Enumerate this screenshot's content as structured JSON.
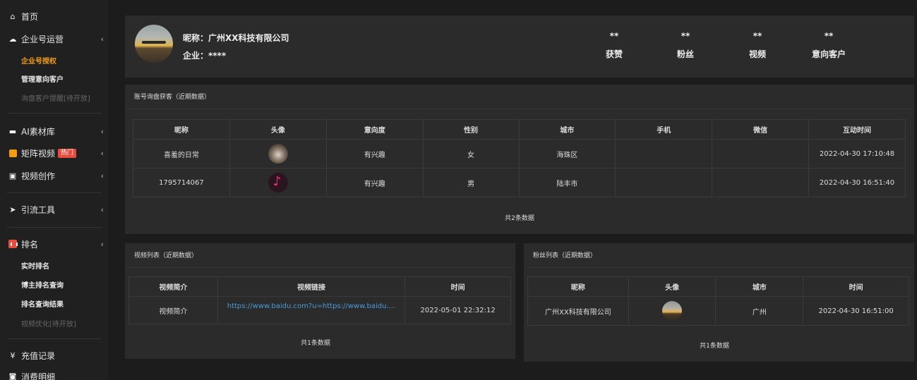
{
  "sidebar": {
    "home": "首页",
    "enterprise": "企业号运营",
    "enterprise_sub": [
      "企业号授权",
      "管理意向客户",
      "询盘客户提醒[待开放]"
    ],
    "ai_material": "AI素材库",
    "matrix_video": "矩阵视频",
    "hot_badge": "热门",
    "video_create": "视频创作",
    "traffic_tool": "引流工具",
    "ranking": "排名",
    "ranking_sub": [
      "实时排名",
      "博主排名查询",
      "排名查询结果",
      "视频优化[待开放]"
    ],
    "recharge": "充值记录",
    "consumption": "消费明细",
    "chevron": "‹"
  },
  "profile": {
    "nickname": "昵称：广州XX科技有限公司",
    "company": "企业：****",
    "stats": [
      {
        "value": "**",
        "label": "获赞"
      },
      {
        "value": "**",
        "label": "粉丝"
      },
      {
        "value": "**",
        "label": "视频"
      },
      {
        "value": "**",
        "label": "意向客户"
      }
    ]
  },
  "inquiry": {
    "title": "账号询盘获客（近期数据）",
    "headers": [
      "昵称",
      "头像",
      "意向度",
      "性别",
      "城市",
      "手机",
      "微信",
      "互动时间"
    ],
    "rows": [
      {
        "nickname": "喜羞的日常",
        "avatar": "dog-avatar",
        "intent": "有兴趣",
        "gender": "女",
        "city": "海珠区",
        "phone": "",
        "wechat": "",
        "time": "2022-04-30 17:10:48"
      },
      {
        "nickname": "1795714067",
        "avatar": "music-avatar",
        "intent": "有兴趣",
        "gender": "男",
        "city": "陆丰市",
        "phone": "",
        "wechat": "",
        "time": "2022-04-30 16:51:40"
      }
    ],
    "footer": "共2条数据"
  },
  "videos": {
    "title": "视频列表（近期数据）",
    "headers": [
      "视频简介",
      "视频链接",
      "时间"
    ],
    "rows": [
      {
        "intro": "视频简介",
        "link": "https://www.baidu.com?u=https://www.baidu....",
        "time": "2022-05-01 22:32:12"
      }
    ],
    "footer": "共1条数据"
  },
  "fans": {
    "title": "粉丝列表（近期数据）",
    "headers": [
      "昵称",
      "头像",
      "城市",
      "时间"
    ],
    "rows": [
      {
        "nickname": "广州XX科技有限公司",
        "avatar": "sunset-avatar",
        "city": "广州",
        "time": "2022-04-30 16:51:00"
      }
    ],
    "footer": "共1条数据"
  },
  "colors": {
    "accent": "#f39c12",
    "hot": "#e74c3c",
    "link": "#4a9bd9"
  }
}
